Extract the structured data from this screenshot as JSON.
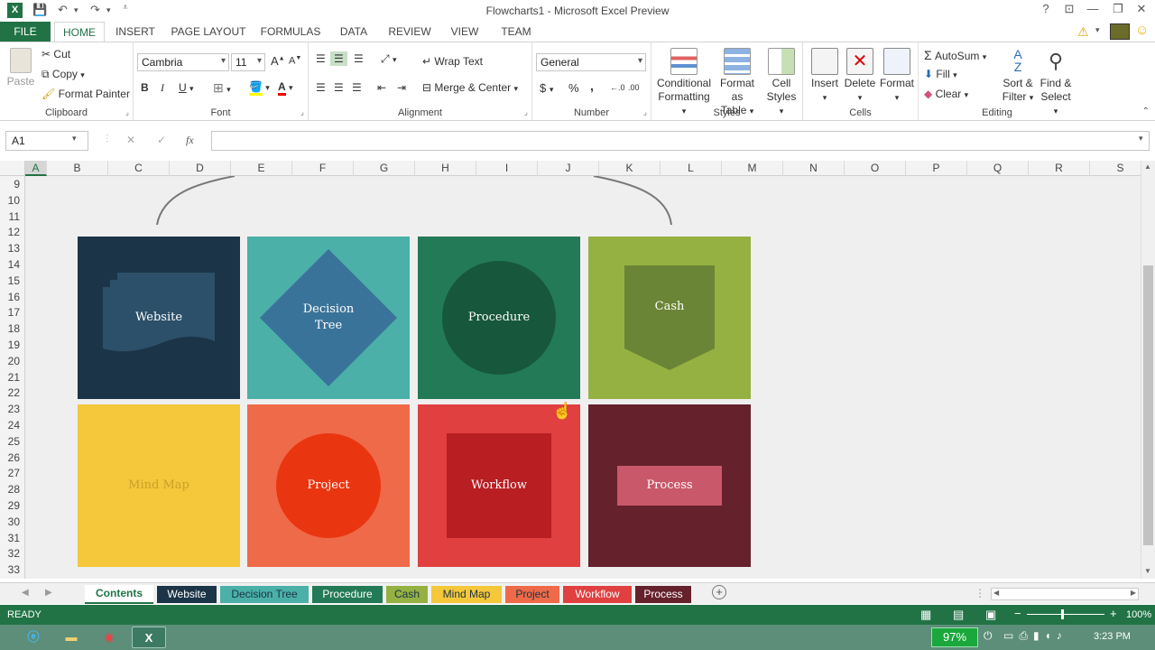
{
  "window": {
    "title": "Flowcharts1 - Microsoft Excel Preview",
    "help": "?",
    "minimize": "—",
    "restore": "❐",
    "close": "✕"
  },
  "ribbon_tabs": [
    "FILE",
    "HOME",
    "INSERT",
    "PAGE LAYOUT",
    "FORMULAS",
    "DATA",
    "REVIEW",
    "VIEW",
    "TEAM"
  ],
  "clipboard": {
    "paste": "Paste",
    "cut": "Cut",
    "copy": "Copy",
    "format_painter": "Format Painter",
    "label": "Clipboard"
  },
  "font": {
    "name": "Cambria",
    "size": "11",
    "bold": "B",
    "italic": "I",
    "underline": "U",
    "grow": "A",
    "shrink": "A",
    "label": "Font"
  },
  "alignment": {
    "wrap": "Wrap Text",
    "merge": "Merge & Center",
    "label": "Alignment"
  },
  "number": {
    "format": "General",
    "currency": "$",
    "percent": "%",
    "comma": ",",
    "label": "Number"
  },
  "styles": {
    "conditional": "Conditional",
    "conditional2": "Formatting",
    "format_table": "Format as",
    "format_table2": "Table",
    "cell": "Cell",
    "cell2": "Styles",
    "label": "Styles"
  },
  "cells": {
    "insert": "Insert",
    "delete": "Delete",
    "format": "Format",
    "label": "Cells"
  },
  "editing": {
    "autosum": "AutoSum",
    "fill": "Fill",
    "clear": "Clear",
    "sort": "Sort &",
    "sort2": "Filter",
    "find": "Find &",
    "find2": "Select",
    "label": "Editing"
  },
  "formula_bar": {
    "name_box": "A1",
    "fx": "fx",
    "cancel": "✕",
    "enter": "✓",
    "value": ""
  },
  "columns": [
    "A",
    "B",
    "C",
    "D",
    "E",
    "F",
    "G",
    "H",
    "I",
    "J",
    "K",
    "L",
    "M",
    "N",
    "O",
    "P",
    "Q",
    "R",
    "S"
  ],
  "rows": [
    "9",
    "10",
    "11",
    "12",
    "13",
    "14",
    "15",
    "16",
    "17",
    "18",
    "19",
    "20",
    "21",
    "22",
    "23",
    "24",
    "25",
    "26",
    "27",
    "28",
    "29",
    "30",
    "31",
    "32",
    "33"
  ],
  "tiles": [
    {
      "label1": "Website",
      "label2": "",
      "bg": "#1b3447",
      "shape": "#2c5069"
    },
    {
      "label1": "Decision",
      "label2": "Tree",
      "bg": "#4ab0a8",
      "shape": "#3a7399"
    },
    {
      "label1": "Procedure",
      "label2": "",
      "bg": "#237a56",
      "shape": "#17573c"
    },
    {
      "label1": "Cash",
      "label2": "",
      "bg": "#95b141",
      "shape": "#6a8535"
    },
    {
      "label1": "Mind Map",
      "label2": "",
      "bg": "#f5c73a",
      "shape": "#c9a02c"
    },
    {
      "label1": "Project",
      "label2": "",
      "bg": "#ef6a48",
      "shape": "#ea3511"
    },
    {
      "label1": "Workflow",
      "label2": "",
      "bg": "#e04040",
      "shape": "#b81e22"
    },
    {
      "label1": "Process",
      "label2": "",
      "bg": "#65212c",
      "shape": "#c9586a"
    }
  ],
  "sheet_tabs": [
    {
      "label": "Contents",
      "color": "#ffffff",
      "text": "#217346"
    },
    {
      "label": "Website",
      "color": "#1b3447",
      "text": "#ffffff"
    },
    {
      "label": "Decision Tree",
      "color": "#4ab0a8",
      "text": "#1b3447"
    },
    {
      "label": "Procedure",
      "color": "#237a56",
      "text": "#ffffff"
    },
    {
      "label": "Cash",
      "color": "#95b141",
      "text": "#1b3447"
    },
    {
      "label": "Mind Map",
      "color": "#f5c73a",
      "text": "#1b3447"
    },
    {
      "label": "Project",
      "color": "#ef6a48",
      "text": "#1b3447"
    },
    {
      "label": "Workflow",
      "color": "#e04040",
      "text": "#ffffff"
    },
    {
      "label": "Process",
      "color": "#65212c",
      "text": "#ffffff"
    }
  ],
  "status": {
    "ready": "READY",
    "zoom": "100%"
  },
  "taskbar": {
    "battery": "97%",
    "time": "3:23 PM"
  }
}
